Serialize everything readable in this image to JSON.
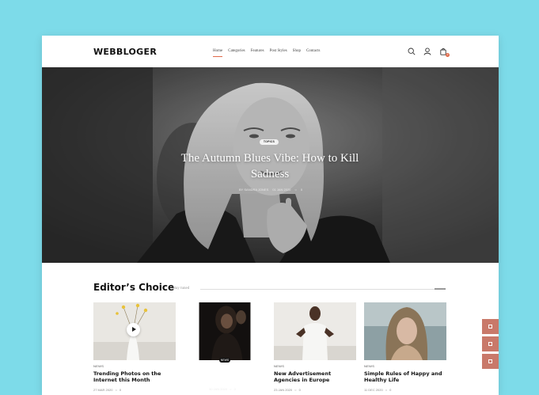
{
  "brand": {
    "logo": "WEBBLOGER",
    "accent": "#e06a4a"
  },
  "nav": {
    "items": [
      "Home",
      "Categories",
      "Features",
      "Post Styles",
      "Shop",
      "Contacts"
    ],
    "active": "Home"
  },
  "header_icons": [
    "search-icon",
    "user-icon",
    "cart-icon"
  ],
  "cart_count": "0",
  "hero": {
    "tag": "TOPICS",
    "title": "The Autumn Blues Vibe: How to Kill Sadness",
    "author": "BY SANDRA JONES",
    "date": "01 JAN 2020",
    "comments": "0"
  },
  "editors_choice": {
    "title": "Editor’s Choice",
    "subtitle": "Stay tuned",
    "cards": [
      {
        "category": "NEWS",
        "title": "Trending Photos on the Internet this Month",
        "date": "27 MAR 2020",
        "comments": "0"
      },
      {
        "category": "NEWS",
        "title": "The Best Clothing Brand Commercial",
        "date": "30 JAN 2020",
        "comments": "0"
      },
      {
        "category": "NEWS",
        "title": "New Advertisement Agencies in Europe",
        "date": "23 JAN 2020",
        "comments": "0"
      },
      {
        "category": "NEWS",
        "title": "Simple Rules of Happy and Healthy Life",
        "date": "11 DEC 2020",
        "comments": "0"
      }
    ]
  },
  "side_buttons": [
    "side-button-1",
    "side-button-2",
    "side-button-3"
  ]
}
